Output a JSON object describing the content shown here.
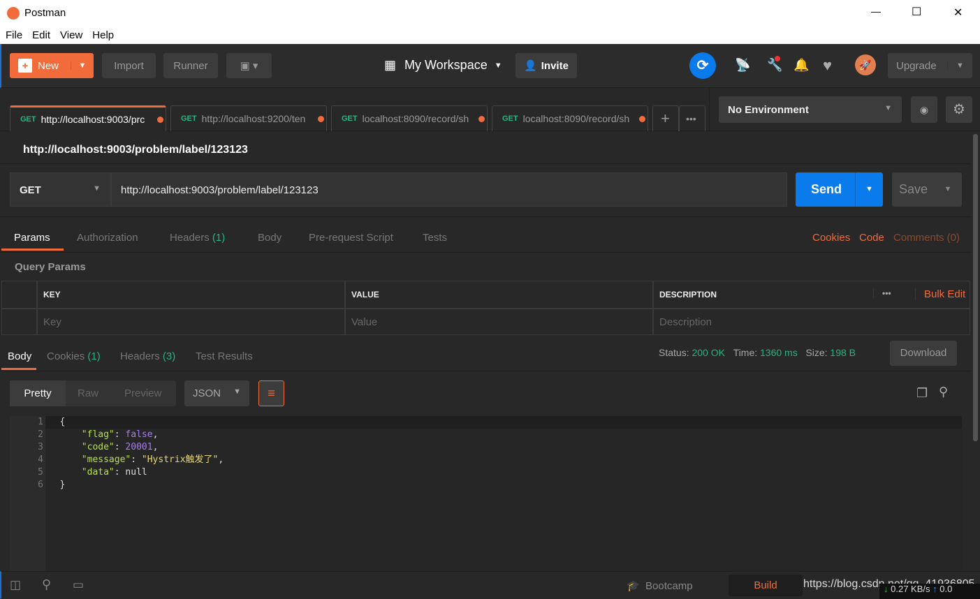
{
  "window": {
    "title": "Postman",
    "minimize": "—",
    "maximize": "☐",
    "close": "✕"
  },
  "menu": [
    "File",
    "Edit",
    "View",
    "Help"
  ],
  "toolbar": {
    "new": "New",
    "import": "Import",
    "runner": "Runner",
    "workspace": "My Workspace",
    "invite": "Invite",
    "upgrade": "Upgrade"
  },
  "tabs": [
    {
      "method": "GET",
      "url": "http://localhost:9003/prc"
    },
    {
      "method": "GET",
      "url": "http://localhost:9200/ten"
    },
    {
      "method": "GET",
      "url": "localhost:8090/record/sh"
    },
    {
      "method": "GET",
      "url": "localhost:8090/record/sh"
    }
  ],
  "environment": "No Environment",
  "request": {
    "title": "http://localhost:9003/problem/label/123123",
    "method": "GET",
    "url": "http://localhost:9003/problem/label/123123",
    "send": "Send",
    "save": "Save"
  },
  "req_tabs": {
    "params": "Params",
    "authorization": "Authorization",
    "headers": "Headers",
    "headers_count": "(1)",
    "body": "Body",
    "prerequest": "Pre-request Script",
    "tests": "Tests",
    "cookies": "Cookies",
    "code": "Code",
    "comments": "Comments (0)"
  },
  "query": {
    "title": "Query Params",
    "headers": [
      "KEY",
      "VALUE",
      "DESCRIPTION"
    ],
    "bulk_edit": "Bulk Edit",
    "placeholders": [
      "Key",
      "Value",
      "Description"
    ]
  },
  "resp_tabs": {
    "body": "Body",
    "cookies": "Cookies",
    "cookies_count": "(1)",
    "headers": "Headers",
    "headers_count": "(3)",
    "tests": "Test Results"
  },
  "status": {
    "status_label": "Status:",
    "status": "200 OK",
    "time_label": "Time:",
    "time": "1360 ms",
    "size_label": "Size:",
    "size": "198 B",
    "download": "Download"
  },
  "view": {
    "pretty": "Pretty",
    "raw": "Raw",
    "preview": "Preview",
    "format": "JSON"
  },
  "code_lines": [
    "1",
    "2",
    "3",
    "4",
    "5",
    "6"
  ],
  "json": {
    "open": "{",
    "flag_k": "\"flag\"",
    "flag_v": "false",
    "code_k": "\"code\"",
    "code_v": "20001",
    "msg_k": "\"message\"",
    "msg_v": "\"Hystrix触发了\"",
    "data_k": "\"data\"",
    "data_v": "null",
    "close": "}"
  },
  "footer": {
    "bootcamp": "Bootcamp",
    "build": "Build",
    "watermark": "https://blog.csdn.net/qq_41936805",
    "speed_down": "0.27 KB/s",
    "speed_up": "0.0"
  },
  "colors": {
    "accent": "#f26b3a",
    "send": "#097bed",
    "success": "#26b47f"
  }
}
